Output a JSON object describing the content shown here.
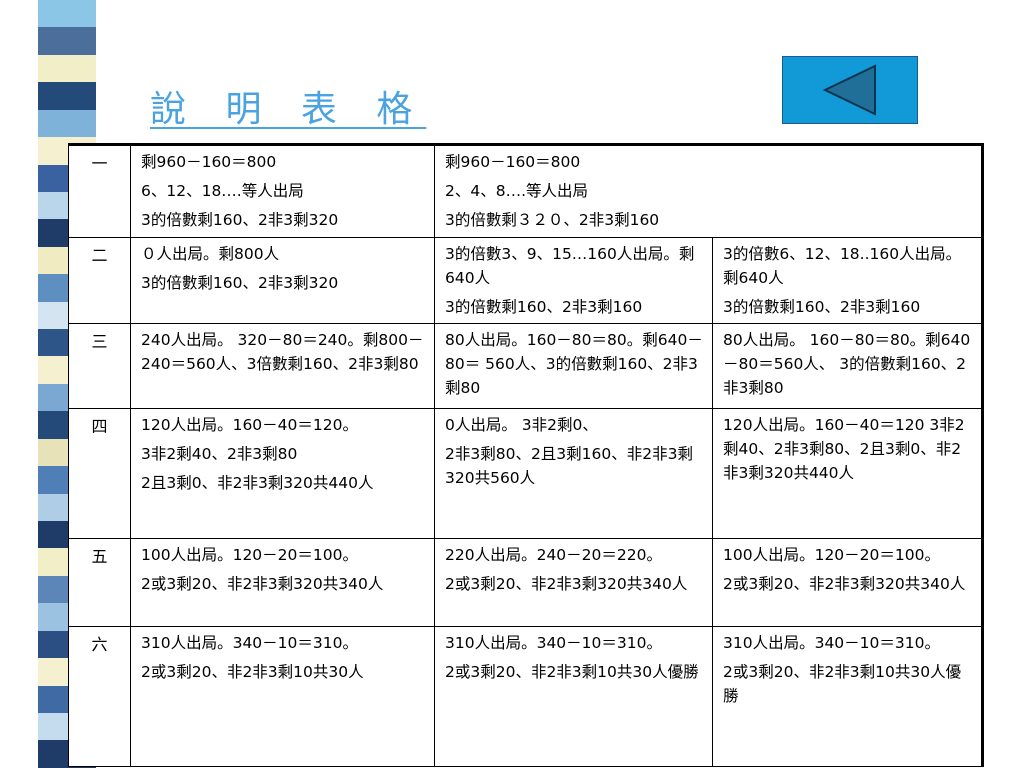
{
  "title": "說 明 表 格",
  "back_button": {
    "icon": "left-triangle-icon"
  },
  "stripe_colors": [
    "#8cc6e6",
    "#4b6f9a",
    "#f2eec8",
    "#244a7a",
    "#7fb2d8",
    "#f5f1d0",
    "#3b62a0",
    "#b9d6ea",
    "#1f3c68",
    "#f0ebc0",
    "#5d8fc0",
    "#d4e4f0",
    "#2e5588",
    "#f5f1d0",
    "#7aa8d2",
    "#244a7a",
    "#e8e2b8",
    "#4f7fb6",
    "#b0cde6",
    "#1f3c68",
    "#f2eec8",
    "#5c86b8",
    "#9cc2e2",
    "#2b4f82",
    "#f5f1d0",
    "#3f6aa4",
    "#c4dcee",
    "#1f3c68"
  ],
  "table": {
    "rows": [
      {
        "head": "一",
        "cells": [
          {
            "lines": [
              "剩960－160＝800",
              "6、12、18….等人出局",
              "3的倍數剩160、2非3剩320"
            ]
          },
          {
            "span": 2,
            "lines": [
              "剩960－160＝800",
              "2、4、8….等人出局",
              "3的倍數剩３２０、2非3剩160"
            ]
          }
        ]
      },
      {
        "head": "二",
        "cells": [
          {
            "lines": [
              "０人出局。剩800人",
              "3的倍數剩160、2非3剩320"
            ]
          },
          {
            "lines": [
              "3的倍數3、9、15…160人出局。剩640人",
              "3的倍數剩160、2非3剩160"
            ]
          },
          {
            "lines": [
              "3的倍數6、12、18..160人出局。剩640人",
              "3的倍數剩160、2非3剩160"
            ]
          }
        ]
      },
      {
        "head": "三",
        "cells": [
          {
            "lines": [
              "240人出局。 320－80＝240。剩800－240＝560人、3倍數剩160、2非3剩80"
            ]
          },
          {
            "lines": [
              "80人出局。160－80＝80。剩640－80＝ 560人、3的倍數剩160、2非3剩80"
            ]
          },
          {
            "lines": [
              "80人出局。 160－80＝80。剩640－80＝560人、 3的倍數剩160、2非3剩80"
            ]
          }
        ]
      },
      {
        "head": "四",
        "cells": [
          {
            "lines": [
              "120人出局。160－40＝120。",
              "3非2剩40、2非3剩80",
              "2且3剩0、非2非3剩320共440人"
            ]
          },
          {
            "lines": [
              "0人出局。 3非2剩0、",
              "2非3剩80、2且3剩160、非2非3剩320共560人"
            ]
          },
          {
            "lines": [
              "120人出局。160－40＝120 3非2剩40、2非3剩80、2且3剩0、非2非3剩320共440人"
            ]
          }
        ]
      },
      {
        "head": "五",
        "cells": [
          {
            "lines": [
              "100人出局。120－20＝100。",
              "2或3剩20、非2非3剩320共340人"
            ]
          },
          {
            "lines": [
              "220人出局。240－20＝220。",
              "2或3剩20、非2非3剩320共340人"
            ]
          },
          {
            "lines": [
              "100人出局。120－20＝100。",
              "2或3剩20、非2非3剩320共340人"
            ]
          }
        ]
      },
      {
        "head": "六",
        "cells": [
          {
            "lines": [
              "310人出局。340－10＝310。",
              "2或3剩20、非2非3剩10共30人"
            ]
          },
          {
            "lines": [
              "310人出局。340－10＝310。",
              "2或3剩20、非2非3剩10共30人優勝"
            ]
          },
          {
            "lines": [
              "310人出局。340－10＝310。",
              "2或3剩20、非2非3剩10共30人優勝"
            ]
          }
        ]
      }
    ]
  }
}
